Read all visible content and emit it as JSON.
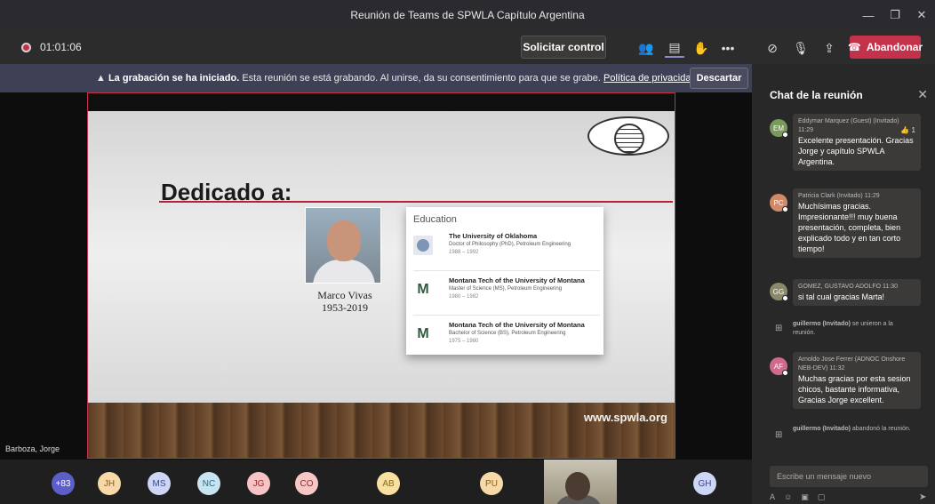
{
  "window": {
    "title": "Reunión de Teams de SPWLA Capítulo Argentina"
  },
  "meeting": {
    "timer": "01:01:06",
    "control_label": "Solicitar control",
    "leave_label": "Abandonar"
  },
  "banner": {
    "bold": "La grabación se ha iniciado.",
    "text": "Esta reunión se está grabando. Al unirse, da su consentimiento para que se grabe.",
    "link": "Política de privacidad",
    "dismiss": "Descartar"
  },
  "stage": {
    "presenter": "Barboza, Jorge"
  },
  "slide": {
    "heading": "Dedicado a:",
    "name": "Marco Vivas",
    "years": "1953-2019",
    "url": "www.spwla.org",
    "edu_title": "Education",
    "education": [
      {
        "school": "The University of Oklahoma",
        "degree": "Doctor of Philosophy (PhD), Petroleum Engineering",
        "years": "1988 – 1992"
      },
      {
        "school": "Montana Tech of the University of Montana",
        "degree": "Master of Science (MS), Petroleum Engineering",
        "years": "1980 – 1982"
      },
      {
        "school": "Montana Tech of the University of Montana",
        "degree": "Bachelor of Science (BS), Petroleum Engineering",
        "years": "1975 – 1980"
      }
    ]
  },
  "chat": {
    "title": "Chat de la reunión",
    "messages": [
      {
        "initials": "EM",
        "meta": "Eddymar Marquez (Guest) (Invitado) 11:29",
        "body": "Excelente presentación. Gracias Jorge y capítulo SPWLA Argentina.",
        "color": "#7a9a5b",
        "reaction": "👍 1"
      },
      {
        "initials": "PC",
        "meta": "Patricia Clark (Invitado) 11:29",
        "body": "Muchísimas gracias. Impresionante!!! muy buena presentación, completa, bien explicado todo y en tan corto tiempo!",
        "color": "#d08a6a"
      },
      {
        "initials": "GG",
        "meta": "GOMEZ, GUSTAVO ADOLFO 11:30",
        "body": "si tal cual gracias Marta!",
        "color": "#8a8a6a"
      },
      {
        "initials": "AF",
        "meta": "Arnoldo Jose Ferrer (ADNOC Onshore NEB-DEV) 11:32",
        "body": "Muchas gracias por esta sesion chicos, bastante informativa, Gracias Jorge excellent.",
        "color": "#d06a8a"
      }
    ],
    "system": [
      {
        "bold": "guillermo (Invitado)",
        "text": "se unieron a la reunión."
      },
      {
        "bold": "guillermo (Invitado)",
        "text": "abandonó la reunión."
      }
    ],
    "composer_placeholder": "Escribe un mensaje nuevo"
  },
  "participants": [
    {
      "initials": "+83",
      "bg": "#5b5fc7",
      "fg": "#ffffff"
    },
    {
      "initials": "JH",
      "bg": "#f7d9a8",
      "fg": "#8a5a1a"
    },
    {
      "initials": "MS",
      "bg": "#cdd6f4",
      "fg": "#3a4a8a"
    },
    {
      "initials": "NC",
      "bg": "#c8e4f0",
      "fg": "#2a6a8a"
    },
    {
      "initials": "JG",
      "bg": "#f6c4c4",
      "fg": "#8a2a2a"
    },
    {
      "initials": "CO",
      "bg": "#f7c7c7",
      "fg": "#8a2a2a"
    },
    {
      "initials": "AB",
      "bg": "#f7e0a0",
      "fg": "#8a6a1a"
    },
    {
      "initials": "PU",
      "bg": "#f7d9a8",
      "fg": "#8a5a1a"
    },
    {
      "initials": "GH",
      "bg": "#cdd6f4",
      "fg": "#3a4a8a"
    }
  ]
}
